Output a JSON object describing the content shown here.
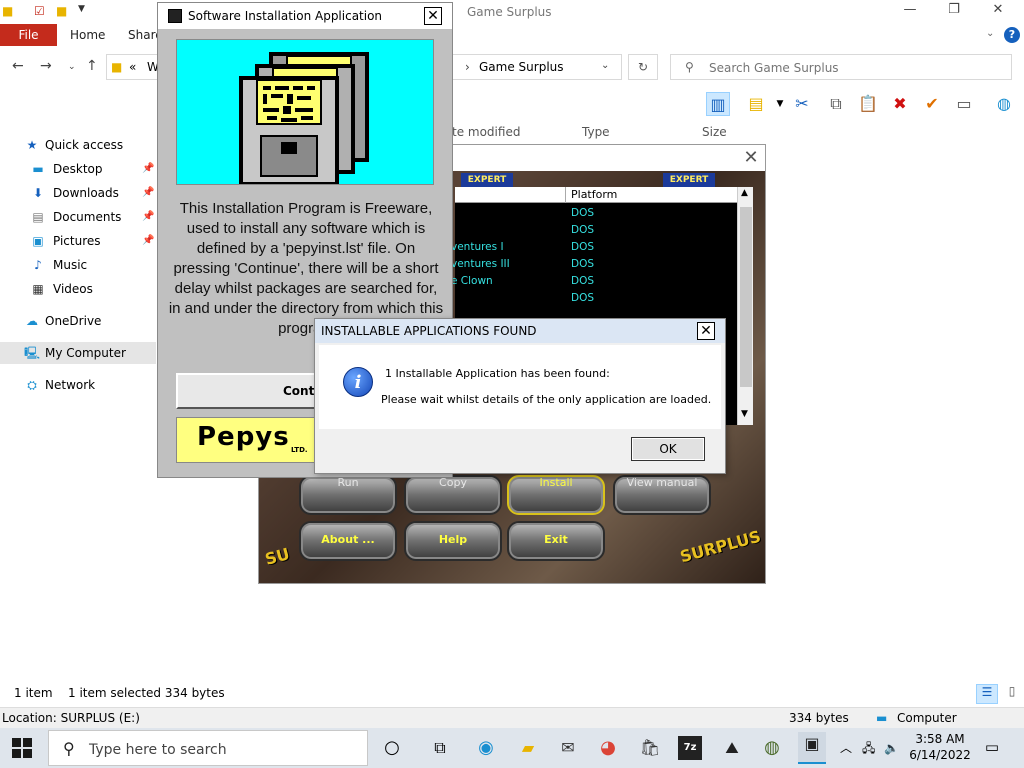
{
  "explorer": {
    "title": "Game Surplus",
    "ribbon_tabs": [
      "File",
      "Home",
      "Share"
    ],
    "address_prefix": "«",
    "address_partial": "W",
    "address_current": "Game Surplus",
    "search_placeholder": "Search Game Surplus",
    "columns": [
      "te modified",
      "Type",
      "Size"
    ],
    "nav": {
      "quick_access": "Quick access",
      "items": [
        "Desktop",
        "Downloads",
        "Documents",
        "Pictures",
        "Music",
        "Videos"
      ],
      "onedrive": "OneDrive",
      "my_computer": "My Computer",
      "network": "Network"
    },
    "status": {
      "count": "1 item",
      "selected": "1 item selected  334 bytes"
    },
    "details": {
      "location": "Location: SURPLUS (E:)",
      "size": "334 bytes",
      "computer": "Computer"
    }
  },
  "game": {
    "expert_badges": [
      "EXPERT",
      "EXPERT"
    ],
    "table_header": {
      "name": "",
      "platform": "Platform"
    },
    "rows": [
      {
        "name": "",
        "platform": "DOS"
      },
      {
        "name": "",
        "platform": "DOS"
      },
      {
        "name": "ventures I",
        "platform": "DOS"
      },
      {
        "name": "ventures III",
        "platform": "DOS"
      },
      {
        "name": "e Clown",
        "platform": "DOS"
      },
      {
        "name": "",
        "platform": "DOS"
      }
    ],
    "buttons_row1": [
      "Run",
      "Copy",
      "Install",
      "View manual"
    ],
    "buttons_row2": [
      "About ...",
      "Help",
      "Exit"
    ],
    "surplus_text": [
      "SURPLUS",
      "SU"
    ]
  },
  "pepys": {
    "title": "Software Installation Application",
    "description": "This Installation Program is Freeware, used to install any software which is defined by a 'pepyinst.lst' file.  On pressing 'Continue', there will be a short delay whilst packages are searched for, in and under the directory from which this program",
    "continue_label": "Contin",
    "logo_text": "Pepys",
    "logo_ltd": "LTD."
  },
  "dialog": {
    "title": "INSTALLABLE APPLICATIONS FOUND",
    "message1": "1 Installable Application has been found:",
    "message2": "Please wait whilst details of the only application are loaded.",
    "ok_label": "OK"
  },
  "taskbar": {
    "search_placeholder": "Type here to search",
    "time": "3:58 AM",
    "date": "6/14/2022"
  }
}
